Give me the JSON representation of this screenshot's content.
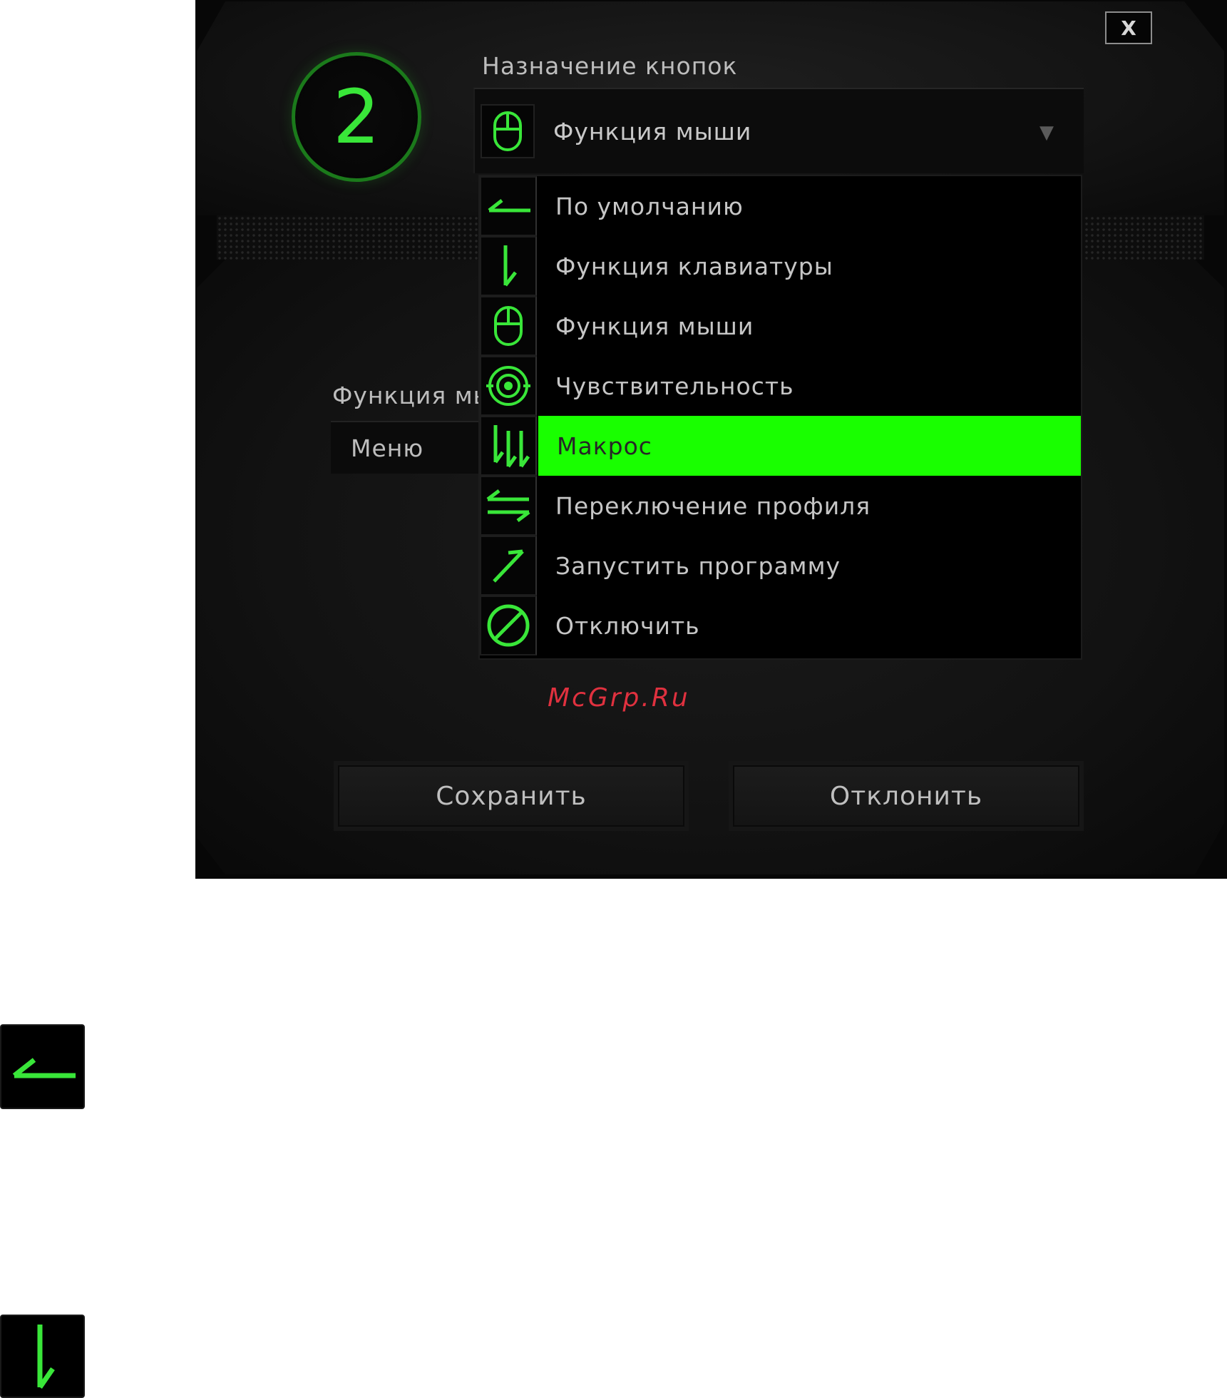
{
  "dialog": {
    "close_label": "X",
    "button_number": "2",
    "section_title": "Назначение кнопок",
    "selected_assignment": "Функция мыши",
    "behind_label": "Функция мы",
    "behind_value": "Меню",
    "save_label": "Сохранить",
    "cancel_label": "Отклонить"
  },
  "menu": {
    "items": [
      {
        "label": "По умолчанию",
        "icon": "default-arrow-icon"
      },
      {
        "label": "Функция клавиатуры",
        "icon": "keyboard-function-icon"
      },
      {
        "label": "Функция мыши",
        "icon": "mouse-icon"
      },
      {
        "label": "Чувствительность",
        "icon": "sensitivity-target-icon"
      },
      {
        "label": "Макрос",
        "icon": "macro-icon",
        "selected": true
      },
      {
        "label": "Переключение профиля",
        "icon": "profile-switch-icon"
      },
      {
        "label": "Запустить программу",
        "icon": "launch-program-icon"
      },
      {
        "label": "Отключить",
        "icon": "disable-icon"
      }
    ]
  },
  "watermark": "McGrp.Ru",
  "colors": {
    "accent_green": "#19ff00",
    "icon_green": "#39e639",
    "background": "#070707",
    "watermark_red": "#e0313f"
  }
}
